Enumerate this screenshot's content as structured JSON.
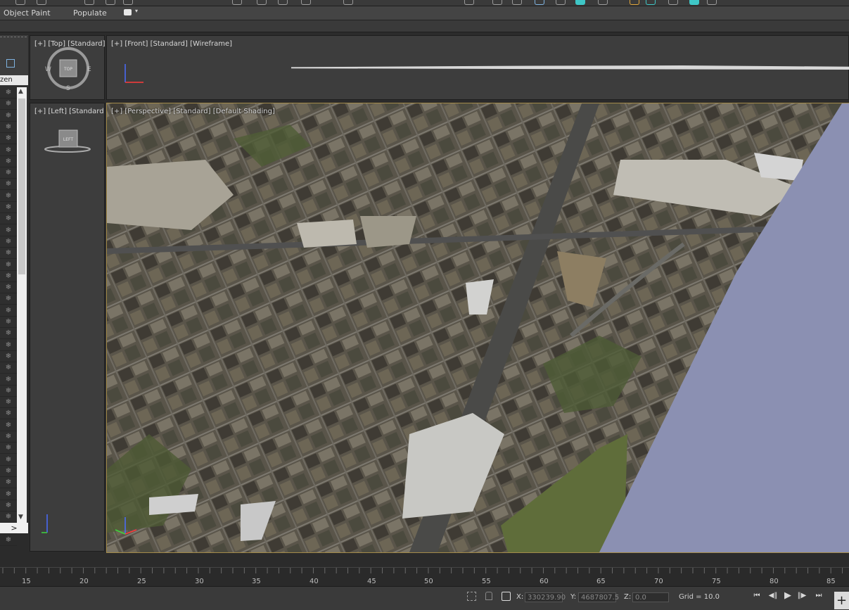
{
  "ribbon": {
    "object_paint": "Object Paint",
    "populate": "Populate"
  },
  "explorer": {
    "header": "zen",
    "row_icon": "❄",
    "scroll_right": ">"
  },
  "viewports": {
    "top": "[+] [Top] [Standard]",
    "front": "[+] [Front] [Standard] [Wireframe]",
    "left": "[+] [Left] [Standard",
    "perspective": "[+] [Perspective] [Standard] [Default Shading]",
    "cube_top": "TOP",
    "cube_left": "LEFT",
    "compass": {
      "w": "W",
      "e": "E",
      "s": "S"
    }
  },
  "timeline": {
    "ticks": [
      "15",
      "20",
      "25",
      "30",
      "35",
      "40",
      "45",
      "50",
      "55",
      "60",
      "65",
      "70",
      "75",
      "80",
      "85"
    ]
  },
  "status": {
    "x_label": "X:",
    "x_value": "330239.90",
    "y_label": "Y:",
    "y_value": "4687807.5",
    "z_label": "Z:",
    "z_value": "0.0",
    "grid": "Grid = 10.0"
  },
  "icons": [
    "explorer-icon",
    "compass-icon",
    "axis-tripod-icon",
    "lock-icon",
    "snap-icon",
    "go-start-icon",
    "prev-frame-icon",
    "play-icon",
    "next-frame-icon",
    "go-end-icon",
    "add-icon"
  ]
}
